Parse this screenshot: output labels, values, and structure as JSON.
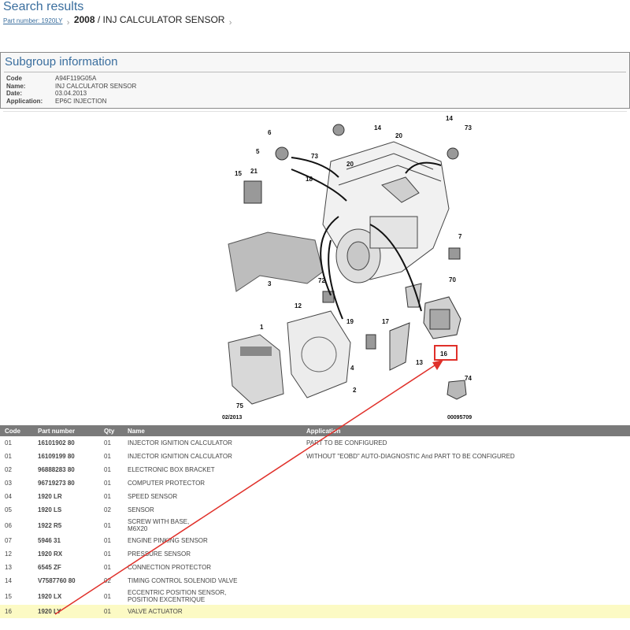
{
  "header": {
    "title": "Search results",
    "breadcrumb_link": "Part number: 1920LY",
    "breadcrumb_code": "2008",
    "breadcrumb_sep": " / ",
    "breadcrumb_name": "INJ CALCULATOR SENSOR"
  },
  "subgroup": {
    "title": "Subgroup information",
    "fields": [
      {
        "label": "Code",
        "value": "A94F119G05A"
      },
      {
        "label": "Name:",
        "value": "INJ CALCULATOR SENSOR"
      },
      {
        "label": "Date:",
        "value": "03.04.2013"
      },
      {
        "label": "Application:",
        "value": "EP6C INJECTION"
      }
    ]
  },
  "diagram": {
    "date_label": "02/2013",
    "ref_label": "00095709",
    "callouts": [
      "6",
      "5",
      "73",
      "14",
      "20",
      "14",
      "20",
      "73",
      "15",
      "21",
      "18",
      "3",
      "7",
      "70",
      "72",
      "12",
      "19",
      "17",
      "16",
      "74",
      "1",
      "4",
      "13",
      "2",
      "75"
    ]
  },
  "table": {
    "headers": [
      "Code",
      "Part number",
      "Qty",
      "Name",
      "Application"
    ],
    "rows": [
      {
        "code": "01",
        "part": "16101902 80",
        "qty": "01",
        "name": "INJECTOR IGNITION CALCULATOR",
        "name2": "",
        "app": "PART TO BE CONFIGURED"
      },
      {
        "code": "01",
        "part": "16109199 80",
        "qty": "01",
        "name": "INJECTOR IGNITION CALCULATOR",
        "name2": "",
        "app": "WITHOUT \"EOBD\" AUTO-DIAGNOSTIC And PART TO BE CONFIGURED"
      },
      {
        "code": "02",
        "part": "96888283 80",
        "qty": "01",
        "name": "ELECTRONIC BOX BRACKET",
        "name2": "",
        "app": ""
      },
      {
        "code": "03",
        "part": "96719273 80",
        "qty": "01",
        "name": "COMPUTER PROTECTOR",
        "name2": "",
        "app": ""
      },
      {
        "code": "04",
        "part": "1920 LR",
        "qty": "01",
        "name": "SPEED SENSOR",
        "name2": "",
        "app": ""
      },
      {
        "code": "05",
        "part": "1920 LS",
        "qty": "02",
        "name": "SENSOR",
        "name2": "",
        "app": ""
      },
      {
        "code": "06",
        "part": "1922 R5",
        "qty": "01",
        "name": "SCREW WITH BASE,",
        "name2": "M6X20",
        "app": ""
      },
      {
        "code": "07",
        "part": "5946 31",
        "qty": "01",
        "name": "ENGINE PINKING SENSOR",
        "name2": "",
        "app": ""
      },
      {
        "code": "12",
        "part": "1920 RX",
        "qty": "01",
        "name": "PRESSURE SENSOR",
        "name2": "",
        "app": ""
      },
      {
        "code": "13",
        "part": "6545 ZF",
        "qty": "01",
        "name": "CONNECTION PROTECTOR",
        "name2": "",
        "app": ""
      },
      {
        "code": "14",
        "part": "V7587760 80",
        "qty": "02",
        "name": "TIMING CONTROL SOLENOID VALVE",
        "name2": "",
        "app": ""
      },
      {
        "code": "15",
        "part": "1920 LX",
        "qty": "01",
        "name": "ECCENTRIC POSITION SENSOR,",
        "name2": "POSITION EXCENTRIQUE",
        "app": ""
      },
      {
        "code": "16",
        "part": "1920 LY",
        "qty": "01",
        "name": "VALVE ACTUATOR",
        "name2": "",
        "app": "",
        "highlight": true
      }
    ]
  },
  "colors": {
    "link": "#3a6e9e",
    "header_bg": "#7a7a7a",
    "highlight_row": "#fcfac4",
    "annotation_red": "#e0302a"
  }
}
